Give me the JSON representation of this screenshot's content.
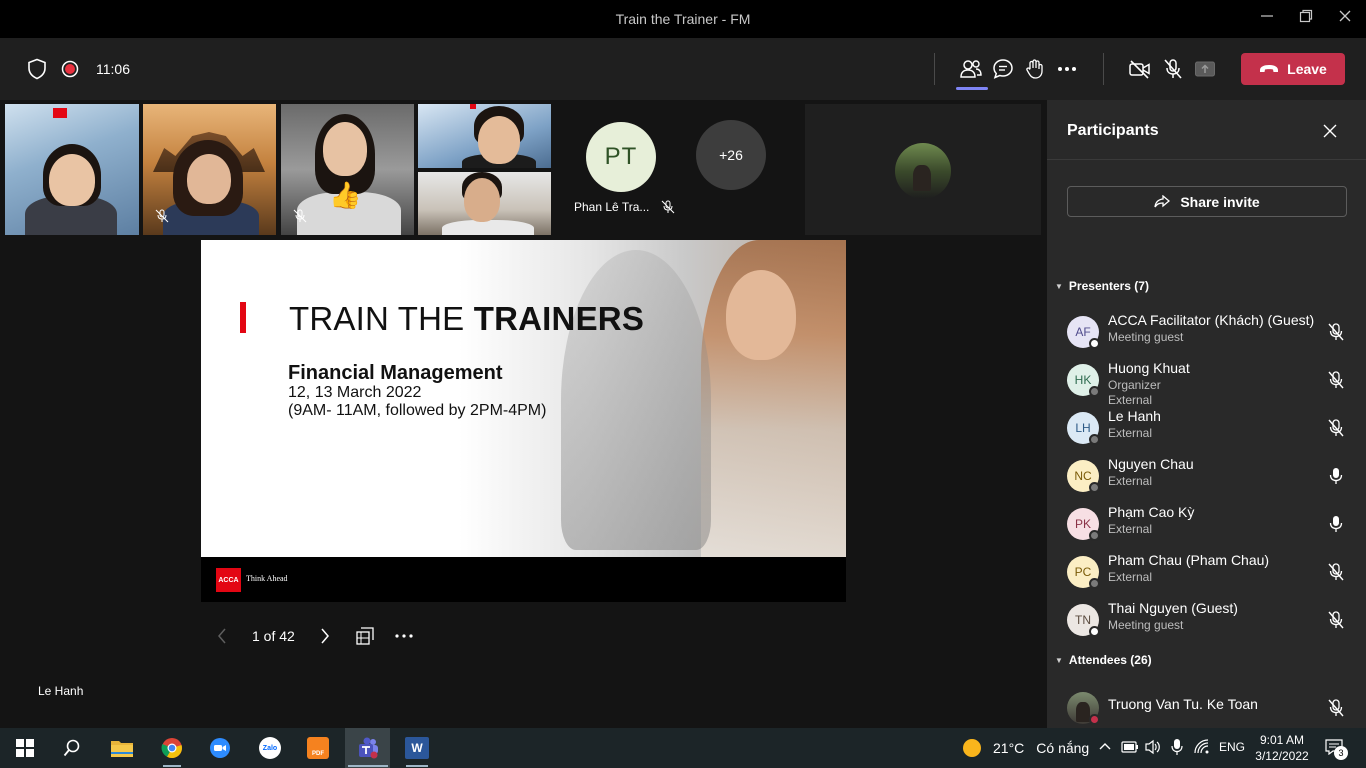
{
  "window": {
    "title": "Train the Trainer - FM",
    "minimize_icon": "minimize-icon",
    "restore_icon": "restore-icon",
    "close_icon": "close-icon"
  },
  "toolbar": {
    "timer": "11:06",
    "leave_label": "Leave",
    "icons": [
      "shield-icon",
      "recording-icon",
      "participants-icon",
      "chat-icon",
      "raise-hand-icon",
      "more-icon",
      "camera-off-icon",
      "mic-off-icon",
      "share-tray-icon",
      "phone-hangup-icon"
    ]
  },
  "stage": {
    "tiles": [
      {
        "name": "video-tile-1"
      },
      {
        "name": "video-tile-2",
        "muted": true
      },
      {
        "name": "video-tile-3",
        "muted": true,
        "reaction": "👍"
      },
      {
        "name": "video-tile-4"
      },
      {
        "name": "video-tile-5"
      }
    ],
    "avatar_tile": {
      "initials": "PT",
      "name": "Phan Lê Tra..."
    },
    "overflow_count": "+26",
    "presenter_name": "Le Hanh"
  },
  "slide": {
    "title_light": "TRAIN THE ",
    "title_bold": "TRAINERS",
    "subtitle": "Financial Management",
    "date_line": "12, 13 March 2022",
    "time_line": "(9AM- 11AM, followed by 2PM-4PM)",
    "logo_text": "ACCA",
    "tagline": "Think Ahead",
    "accent_color": "#e30613"
  },
  "pager": {
    "page_text": "1 of 42"
  },
  "panel": {
    "title": "Participants",
    "share_invite_label": "Share invite",
    "presenters_header": "Presenters (7)",
    "attendees_header": "Attendees (26)",
    "presenters": [
      {
        "initials": "AF",
        "name": "ACCA Facilitator (Khách) (Guest)",
        "sub1": "Meeting guest",
        "sub2": "",
        "avatar_bg": "#e6e4f5",
        "avatar_fg": "#4f4a8c",
        "mic": "off"
      },
      {
        "initials": "HK",
        "name": "Huong Khuat",
        "sub1": "Organizer",
        "sub2": "External",
        "avatar_bg": "#dff0e8",
        "avatar_fg": "#2e6b4f",
        "mic": "off"
      },
      {
        "initials": "LH",
        "name": "Le Hanh",
        "sub1": "External",
        "sub2": "",
        "avatar_bg": "#dbe9f5",
        "avatar_fg": "#2d5a86",
        "mic": "off"
      },
      {
        "initials": "NC",
        "name": "Nguyen Chau",
        "sub1": "External",
        "sub2": "",
        "avatar_bg": "#fbeec4",
        "avatar_fg": "#7a5b08",
        "mic": "on"
      },
      {
        "initials": "PK",
        "name": "Phạm Cao Kỳ",
        "sub1": "External",
        "sub2": "",
        "avatar_bg": "#f7dfe4",
        "avatar_fg": "#8a3146",
        "mic": "on"
      },
      {
        "initials": "PC",
        "name": "Pham Chau (Pham Chau)",
        "sub1": "External",
        "sub2": "",
        "avatar_bg": "#fbeec4",
        "avatar_fg": "#7a5b08",
        "mic": "off"
      },
      {
        "initials": "TN",
        "name": "Thai Nguyen (Guest)",
        "sub1": "Meeting guest",
        "sub2": "",
        "avatar_bg": "#ece7e3",
        "avatar_fg": "#5b4c40",
        "mic": "off"
      }
    ],
    "attendees": [
      {
        "name": "Truong Van Tu. Ke Toan",
        "mic": "off"
      }
    ]
  },
  "taskbar": {
    "apps": [
      "windows-start-icon",
      "search-icon",
      "file-explorer-icon",
      "chrome-icon",
      "zoom-icon",
      "zalo-icon",
      "foxit-pdf-icon",
      "teams-icon",
      "word-icon"
    ],
    "zalo_label": "Zalo",
    "pdf_label": "PDF",
    "word_label": "W",
    "weather_temp": "21°C",
    "weather_desc": "Có nắng",
    "language": "ENG",
    "time": "9:01 AM",
    "date": "3/12/2022",
    "notification_count": "3"
  }
}
